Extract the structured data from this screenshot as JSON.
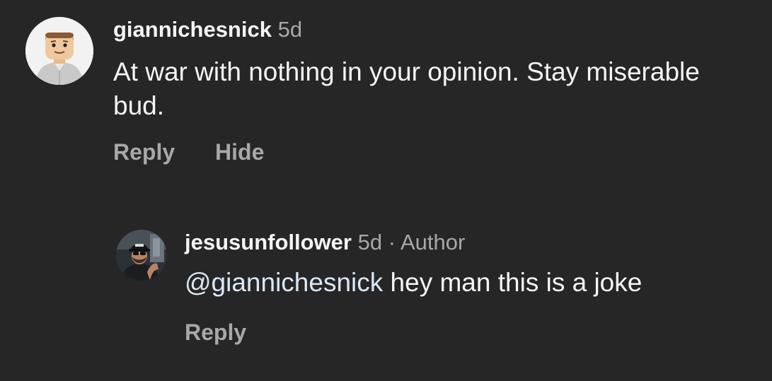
{
  "comment": {
    "username": "giannichesnick",
    "time": "5d",
    "text": "At war with nothing in your opinion. Stay miserable bud.",
    "actions": {
      "reply_label": "Reply",
      "hide_label": "Hide"
    }
  },
  "reply": {
    "username": "jesusunfollower",
    "time": "5d",
    "separator": "·",
    "author_label": "Author",
    "mention": "@giannichesnick",
    "text": " hey man this is a joke",
    "actions": {
      "reply_label": "Reply"
    }
  },
  "colors": {
    "background": "#262626",
    "primary_text": "#f5f5f5",
    "secondary_text": "#a8a8a8",
    "mention": "#dbe7f5"
  },
  "icons": {
    "comment_avatar": "lego-minifigure-avatar",
    "reply_avatar": "profile-photo-avatar"
  }
}
